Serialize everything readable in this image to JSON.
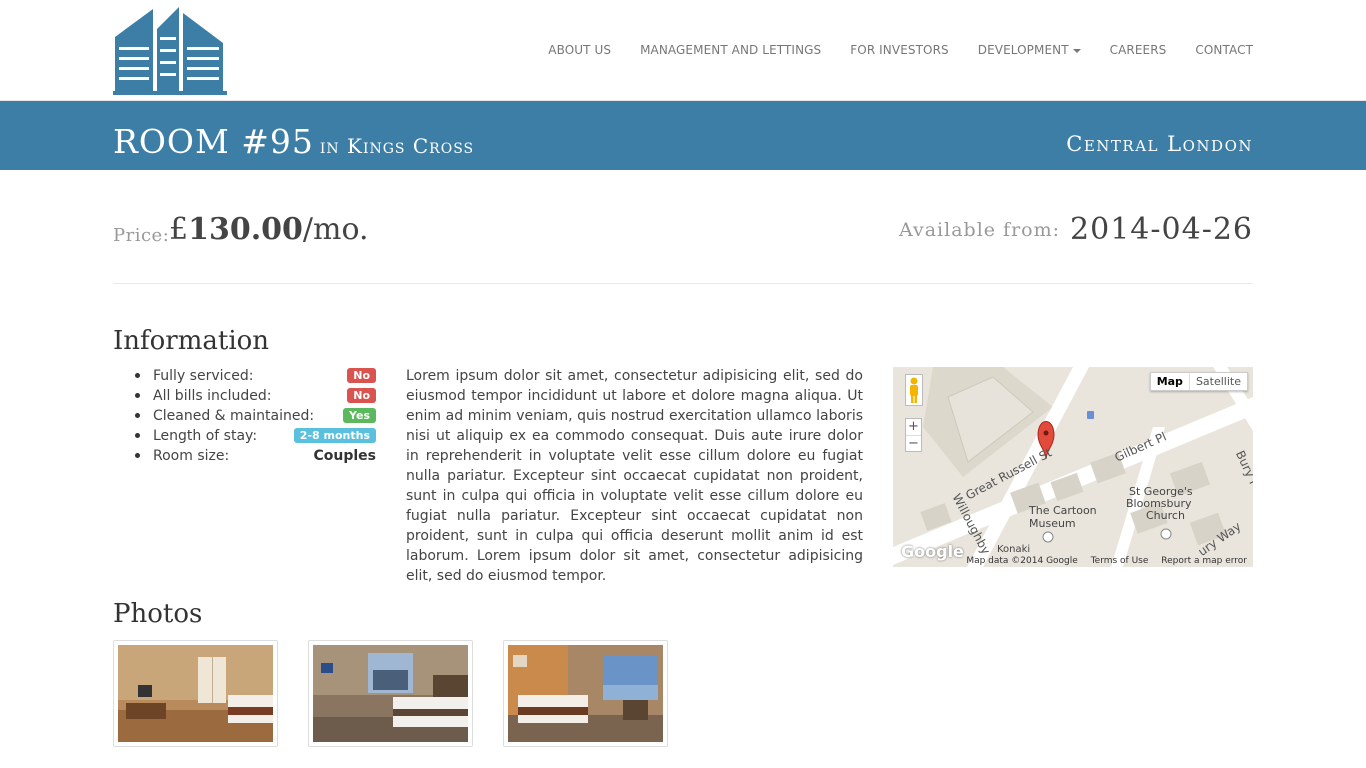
{
  "nav": {
    "items": [
      {
        "label": "ABOUT US"
      },
      {
        "label": "MANAGEMENT AND LETTINGS"
      },
      {
        "label": "FOR INVESTORS"
      },
      {
        "label": "DEVELOPMENT"
      },
      {
        "label": "CAREERS"
      },
      {
        "label": "CONTACT"
      }
    ]
  },
  "banner": {
    "room": "ROOM #95",
    "location": "in Kings Cross",
    "region": "Central London"
  },
  "pricing": {
    "price_label": "Price:",
    "currency": "£",
    "amount": "130.00",
    "period": "/mo.",
    "available_label": "Available from:",
    "available_date": "2014-04-26"
  },
  "info": {
    "heading": "Information",
    "items": [
      {
        "label": "Fully serviced:",
        "value": "No",
        "color": "#d9534f"
      },
      {
        "label": "All bills included:",
        "value": "No",
        "color": "#d9534f"
      },
      {
        "label": "Cleaned & maintained:",
        "value": "Yes",
        "color": "#5cb85c"
      },
      {
        "label": "Length of stay:",
        "value": "2-8 months",
        "color": "#5bc0de"
      },
      {
        "label": "Room size:",
        "value": "Couples"
      }
    ],
    "description": "Lorem ipsum dolor sit amet, consectetur adipisicing elit, sed do eiusmod tempor incididunt ut labore et dolore magna aliqua. Ut enim ad minim veniam, quis nostrud exercitation ullamco laboris nisi ut aliquip ex ea commodo consequat. Duis aute irure dolor in reprehenderit in voluptate velit esse cillum dolore eu fugiat nulla pariatur. Excepteur sint occaecat cupidatat non proident, sunt in culpa qui officia in voluptate velit esse cillum dolore eu fugiat nulla pariatur. Excepteur sint occaecat cupidatat non proident, sunt in culpa qui officia deserunt mollit anim id est laborum. Lorem ipsum dolor sit amet, consectetur adipisicing elit, sed do eiusmod tempor."
  },
  "map": {
    "btn_map": "Map",
    "btn_satellite": "Satellite",
    "zoom_in": "+",
    "zoom_out": "−",
    "logo": "Google",
    "data_credit": "Map data ©2014 Google",
    "terms": "Terms of Use",
    "report": "Report a map error",
    "streets": [
      "Great Russell St",
      "Gilbert Pl",
      "Willoughby",
      "Bury P",
      "ury Way"
    ],
    "places": [
      "St George's",
      "Bloomsbury",
      "Church",
      "The Cartoon",
      "Museum",
      "Konaki"
    ]
  },
  "photos": {
    "heading": "Photos",
    "items": [
      {
        "name": "bedroom-photo-1"
      },
      {
        "name": "bedroom-photo-2"
      },
      {
        "name": "bedroom-photo-3"
      }
    ]
  },
  "colors": {
    "brand": "#3d7ea6",
    "badge_no": "#d9534f",
    "badge_yes": "#5cb85c",
    "badge_info": "#5bc0de"
  }
}
